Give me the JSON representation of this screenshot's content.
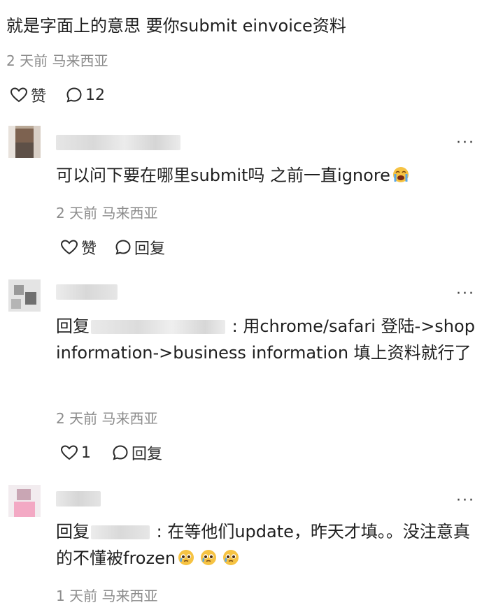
{
  "post": {
    "text": "就是字面上的意思 要你submit einvoice资料",
    "meta": "2 天前 马来西亚",
    "like_label": "赞",
    "comment_count": "12"
  },
  "comments": [
    {
      "text": "可以问下要在哪里submit吗 之前一直ignore",
      "meta": "2 天前 马来西亚",
      "like_label": "赞",
      "reply_label": "回复"
    },
    {
      "reply_prefix": "回复",
      "text_after_mention": " : 用chrome/safari 登陆->shop information->business information 填上资料就行了",
      "meta": "2 天前 马来西亚",
      "like_count": "1",
      "reply_label": "回复"
    },
    {
      "reply_prefix": "回复",
      "text_after_mention": " : 在等他们update，昨天才填。。没注意真的不懂被frozen",
      "meta": "1 天前 马来西亚"
    }
  ],
  "more_label": "···",
  "colors": {
    "text": "#1f1f1f",
    "meta": "#8c8c8c",
    "emoji": "#f6c343",
    "tear": "#5aa7e6"
  }
}
